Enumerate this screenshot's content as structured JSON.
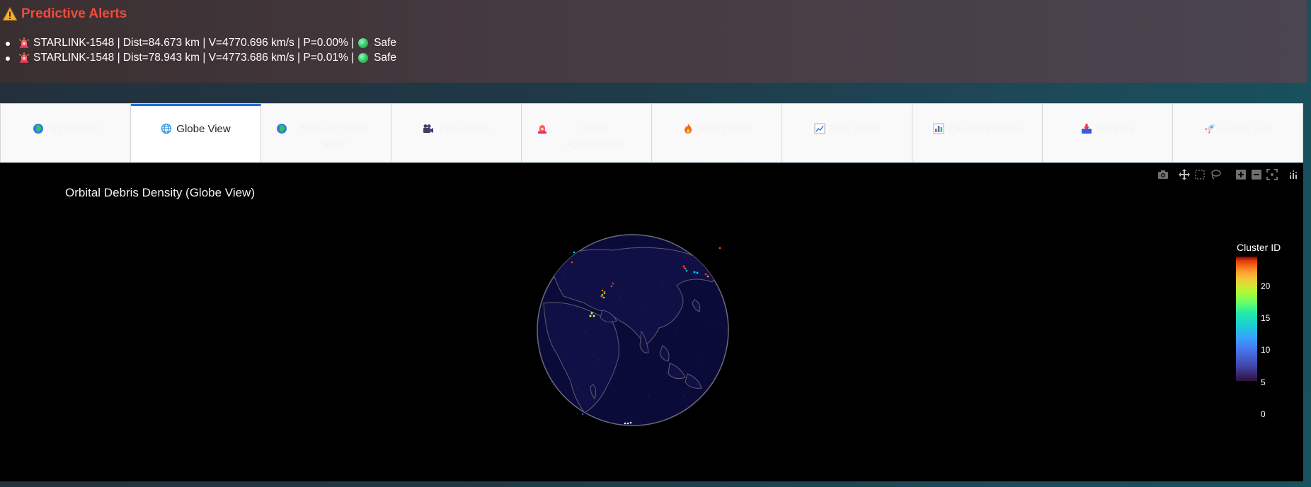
{
  "alerts": {
    "title": "Predictive Alerts",
    "items": [
      {
        "text": "STARLINK-1548 | Dist=84.673 km | V=4770.696 km/s | P=0.00% |",
        "status": "Safe"
      },
      {
        "text": "STARLINK-1548 | Dist=78.943 km | V=4773.686 km/s | P=0.01% |",
        "status": "Safe"
      }
    ]
  },
  "tabs": [
    {
      "label": "3D Scatter",
      "icon": "globe-icon",
      "active": false
    },
    {
      "label": "Globe View",
      "icon": "globe-grid-icon",
      "active": true
    },
    {
      "label": "Textured Earth View",
      "icon": "globe-icon",
      "active": false
    },
    {
      "label": "Time-lapse",
      "icon": "camera-icon",
      "active": false
    },
    {
      "label": "Close Approaches",
      "icon": "siren-icon",
      "active": false
    },
    {
      "label": "Risk Zones",
      "icon": "fire-icon",
      "active": false
    },
    {
      "label": "Risk Trend",
      "icon": "chart-line-icon",
      "active": false
    },
    {
      "label": "Cluster Insights",
      "icon": "bar-chart-icon",
      "active": false
    },
    {
      "label": "Reports",
      "icon": "inbox-download-icon",
      "active": false
    },
    {
      "label": "Future Sim",
      "icon": "rocket-icon",
      "active": false
    }
  ],
  "plot": {
    "title": "Orbital Debris Density (Globe View)",
    "colorbar": {
      "title": "Cluster ID",
      "ticks": [
        "20",
        "15",
        "10",
        "5",
        "0"
      ]
    }
  },
  "colors": {
    "alert_title": "#ef4b3d",
    "active_tab_border": "#1f6fe0",
    "globe_ocean": "#0b0b3a"
  }
}
